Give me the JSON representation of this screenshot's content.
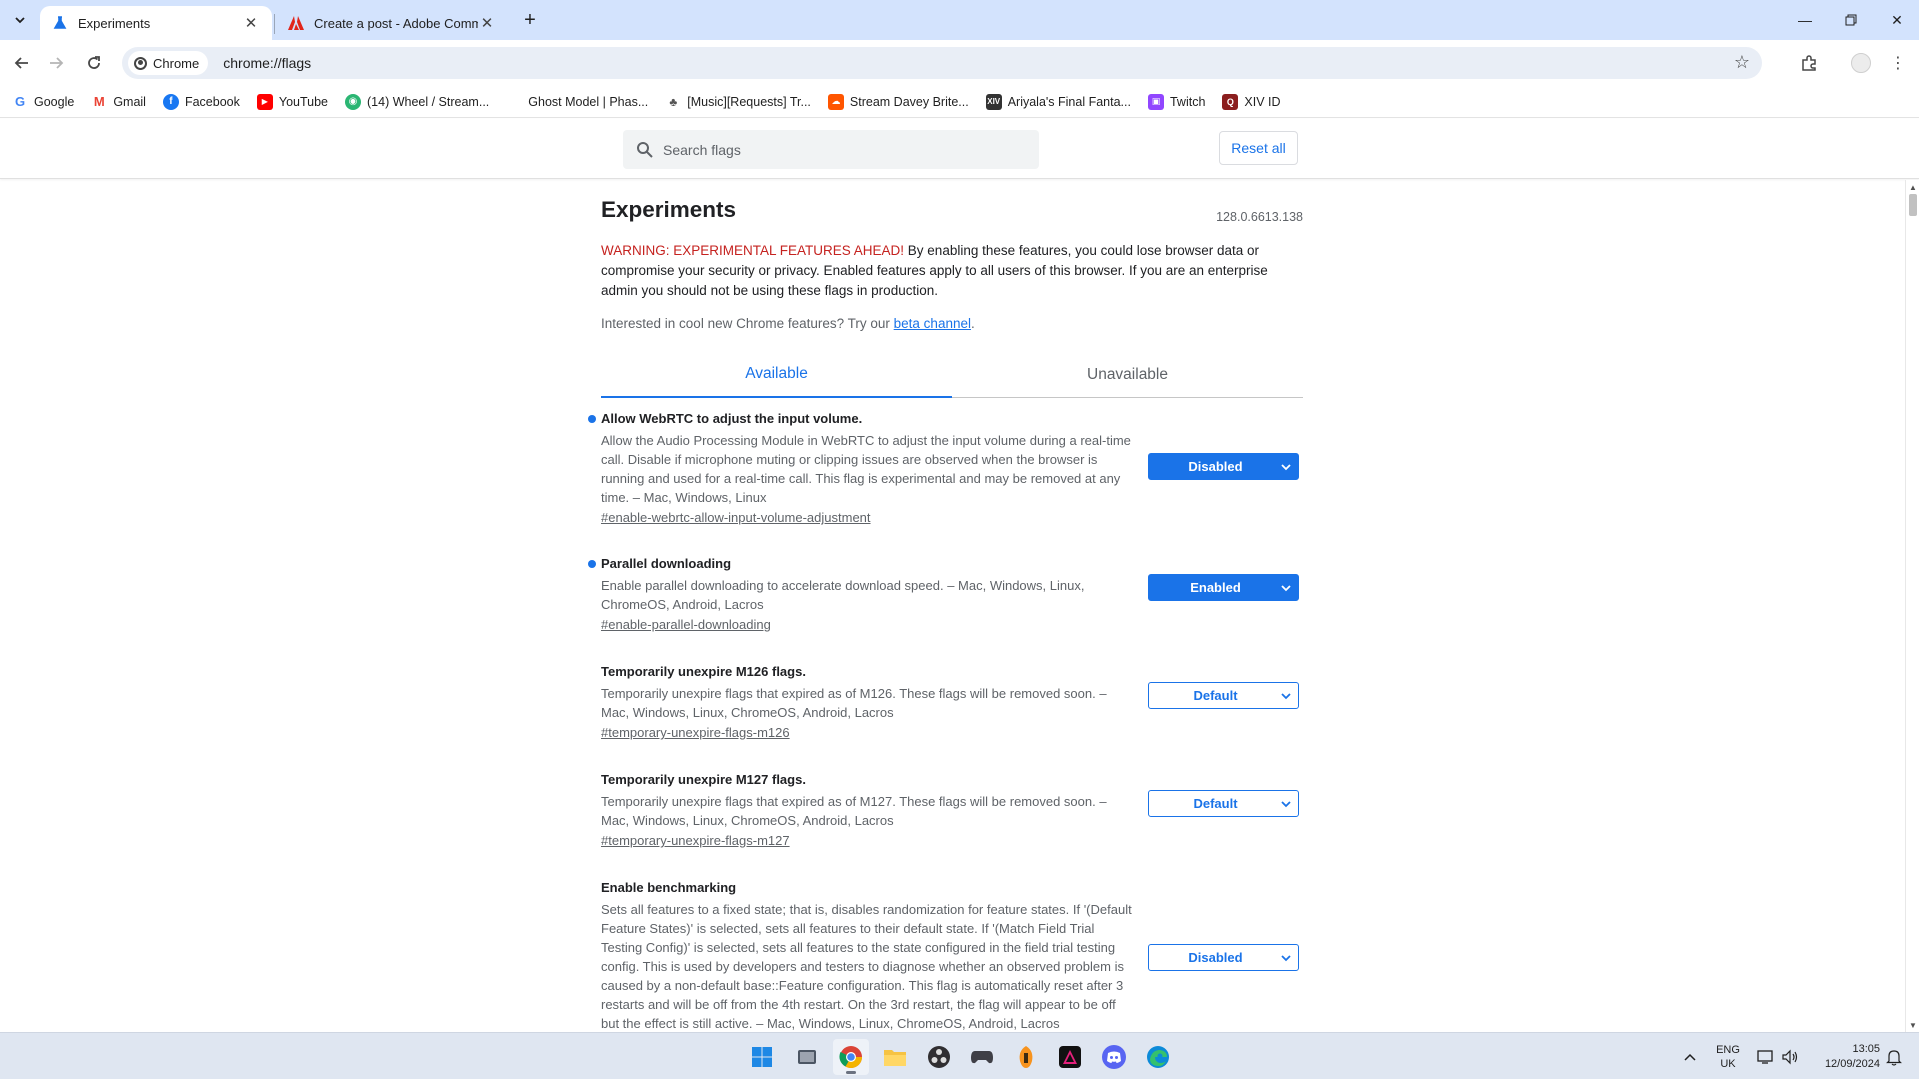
{
  "browser": {
    "tabs": [
      {
        "title": "Experiments",
        "active": true,
        "icon": "flask-icon"
      },
      {
        "title": "Create a post - Adobe Commun",
        "active": false,
        "icon": "adobe-icon"
      }
    ],
    "new_tab_label": "+",
    "address": {
      "chip_label": "Chrome",
      "url": "chrome://flags"
    },
    "bookmarks": [
      {
        "label": "Google",
        "icon": "google-icon"
      },
      {
        "label": "Gmail",
        "icon": "gmail-icon"
      },
      {
        "label": "Facebook",
        "icon": "facebook-icon"
      },
      {
        "label": "YouTube",
        "icon": "youtube-icon"
      },
      {
        "label": "(14) Wheel / Stream...",
        "icon": "stream-icon"
      },
      {
        "label": "Ghost Model | Phas...",
        "icon": "blank-icon"
      },
      {
        "label": "[Music][Requests] Tr...",
        "icon": "music-icon"
      },
      {
        "label": "Stream Davey Brite...",
        "icon": "soundcloud-icon"
      },
      {
        "label": "Ariyala's Final Fanta...",
        "icon": "ariyala-icon"
      },
      {
        "label": "Twitch",
        "icon": "twitch-icon"
      },
      {
        "label": "XIV ID",
        "icon": "xivid-icon"
      }
    ]
  },
  "flags_page": {
    "search_placeholder": "Search flags",
    "reset_label": "Reset all",
    "title": "Experiments",
    "version": "128.0.6613.138",
    "warning_red": "WARNING: EXPERIMENTAL FEATURES AHEAD!",
    "warning_rest": " By enabling these features, you could lose browser data or compromise your security or privacy. Enabled features apply to all users of this browser. If you are an enterprise admin you should not be using these flags in production.",
    "beta_prefix": "Interested in cool new Chrome features? Try our ",
    "beta_link": "beta channel",
    "beta_suffix": ".",
    "tabs": {
      "available": "Available",
      "unavailable": "Unavailable"
    },
    "experiments": [
      {
        "name": "Allow WebRTC to adjust the input volume.",
        "description": "Allow the Audio Processing Module in WebRTC to adjust the input volume during a real-time call. Disable if microphone muting or clipping issues are observed when the browser is running and used for a real-time call. This flag is experimental and may be removed at any time. – Mac, Windows, Linux",
        "link": "#enable-webrtc-allow-input-volume-adjustment",
        "value": "Disabled",
        "modified": true
      },
      {
        "name": "Parallel downloading",
        "description": "Enable parallel downloading to accelerate download speed. – Mac, Windows, Linux, ChromeOS, Android, Lacros",
        "link": "#enable-parallel-downloading",
        "value": "Enabled",
        "modified": true
      },
      {
        "name": "Temporarily unexpire M126 flags.",
        "description": "Temporarily unexpire flags that expired as of M126. These flags will be removed soon. – Mac, Windows, Linux, ChromeOS, Android, Lacros",
        "link": "#temporary-unexpire-flags-m126",
        "value": "Default",
        "modified": false
      },
      {
        "name": "Temporarily unexpire M127 flags.",
        "description": "Temporarily unexpire flags that expired as of M127. These flags will be removed soon. – Mac, Windows, Linux, ChromeOS, Android, Lacros",
        "link": "#temporary-unexpire-flags-m127",
        "value": "Default",
        "modified": false
      },
      {
        "name": "Enable benchmarking",
        "description": "Sets all features to a fixed state; that is, disables randomization for feature states. If '(Default Feature States)' is selected, sets all features to their default state. If '(Match Field Trial Testing Config)' is selected, sets all features to the state configured in the field trial testing config. This is used by developers and testers to diagnose whether an observed problem is caused by a non-default base::Feature configuration. This flag is automatically reset after 3 restarts and will be off from the 4th restart. On the 3rd restart, the flag will appear to be off but the effect is still active. – Mac, Windows, Linux, ChromeOS, Android, Lacros",
        "link": "",
        "value": "Disabled",
        "modified": false
      }
    ]
  },
  "taskbar": {
    "apps": [
      "windows-start-icon",
      "task-view-icon",
      "chrome-icon",
      "file-explorer-icon",
      "obs-icon",
      "game-controller-icon",
      "fl-studio-icon",
      "affinity-icon",
      "discord-icon",
      "edge-icon"
    ],
    "language_line1": "ENG",
    "language_line2": "UK",
    "time": "13:05",
    "date": "12/09/2024"
  },
  "colors": {
    "tab_strip": "#d3e3fd",
    "accent": "#1a73e8",
    "warning": "#c5221f",
    "taskbar": "#dfe6f1"
  }
}
